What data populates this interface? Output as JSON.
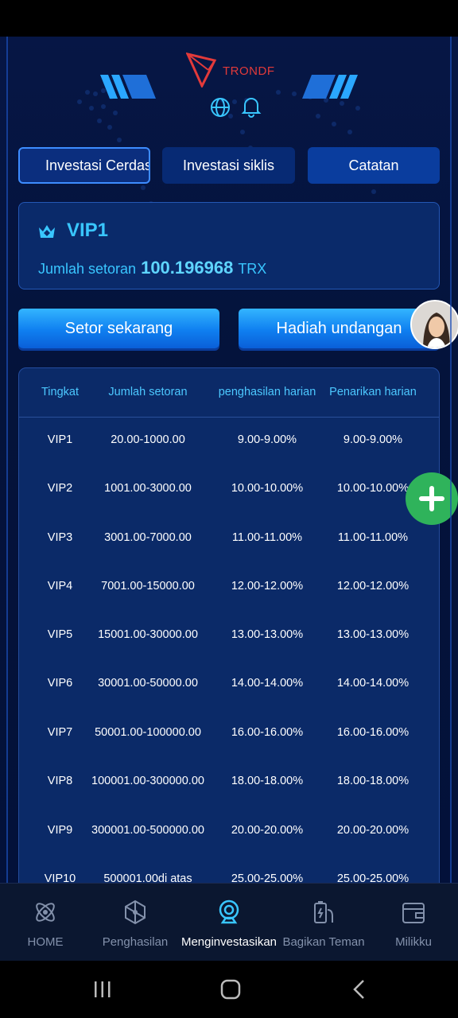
{
  "brand": {
    "logo_text": "TRONDF"
  },
  "header": {
    "globe_icon": "globe-icon",
    "bell_icon": "bell-icon"
  },
  "tabs": [
    {
      "label": "Investasi Cerdas",
      "active": true
    },
    {
      "label": "Investasi siklis",
      "active": false
    },
    {
      "label": "Catatan",
      "active": false
    }
  ],
  "vip_card": {
    "level": "VIP1",
    "deposit_label": "Jumlah setoran",
    "deposit_amount": "100.196968",
    "currency": "TRX"
  },
  "actions": {
    "deposit_label": "Setor sekarang",
    "invite_label": "Hadiah undangan"
  },
  "table": {
    "headers": [
      "Tingkat",
      "Jumlah setoran",
      "penghasilan harian",
      "Penarikan harian"
    ],
    "rows": [
      [
        "VIP1",
        "20.00-1000.00",
        "9.00-9.00%",
        "9.00-9.00%"
      ],
      [
        "VIP2",
        "1001.00-3000.00",
        "10.00-10.00%",
        "10.00-10.00%"
      ],
      [
        "VIP3",
        "3001.00-7000.00",
        "11.00-11.00%",
        "11.00-11.00%"
      ],
      [
        "VIP4",
        "7001.00-15000.00",
        "12.00-12.00%",
        "12.00-12.00%"
      ],
      [
        "VIP5",
        "15001.00-30000.00",
        "13.00-13.00%",
        "13.00-13.00%"
      ],
      [
        "VIP6",
        "30001.00-50000.00",
        "14.00-14.00%",
        "14.00-14.00%"
      ],
      [
        "VIP7",
        "50001.00-100000.00",
        "16.00-16.00%",
        "16.00-16.00%"
      ],
      [
        "VIP8",
        "100001.00-300000.00",
        "18.00-18.00%",
        "18.00-18.00%"
      ],
      [
        "VIP9",
        "300001.00-500000.00",
        "20.00-20.00%",
        "20.00-20.00%"
      ],
      [
        "VIP10",
        "500001.00di atas",
        "25.00-25.00%",
        "25.00-25.00%"
      ]
    ]
  },
  "bottom_nav": [
    {
      "label": "HOME",
      "icon": "atom-icon",
      "active": false
    },
    {
      "label": "Penghasilan",
      "icon": "network-icon",
      "active": false
    },
    {
      "label": "Menginvestasikan",
      "icon": "webcam-icon",
      "active": true
    },
    {
      "label": "Bagikan Teman",
      "icon": "share-battery-icon",
      "active": false
    },
    {
      "label": "Milikku",
      "icon": "wallet-icon",
      "active": false
    }
  ],
  "colors": {
    "accent": "#39c6ff",
    "button": "#0f7ff0",
    "fab": "#2fb35b",
    "brand_red": "#e23a3a"
  }
}
